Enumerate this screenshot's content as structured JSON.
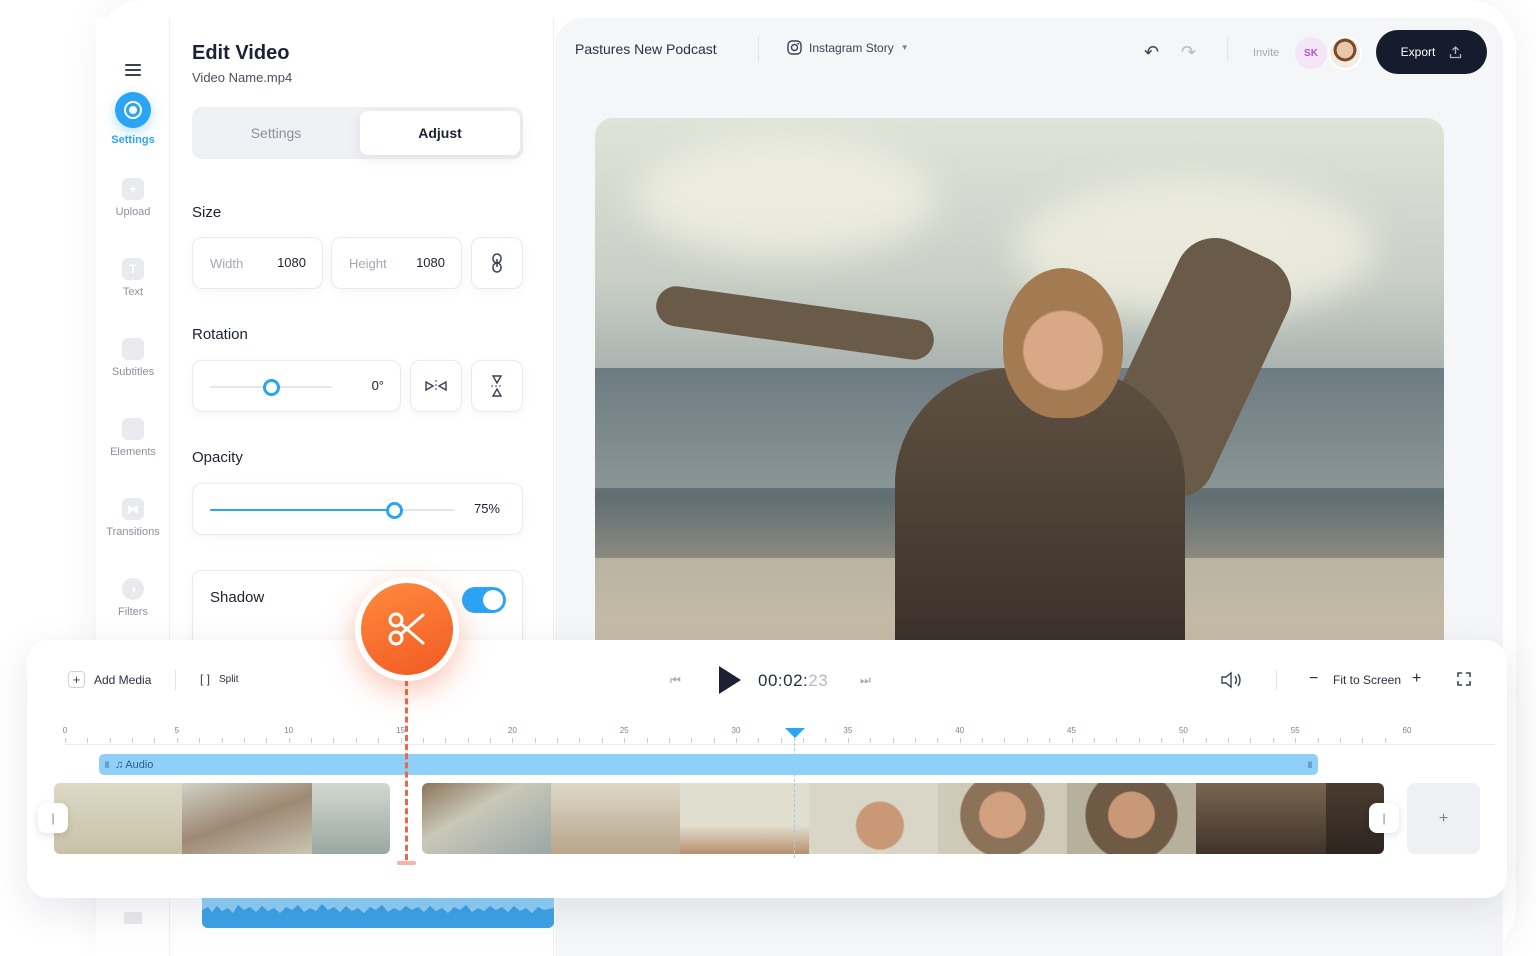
{
  "rail": {
    "items": [
      {
        "label": "Settings",
        "icon": "settings-icon"
      },
      {
        "label": "Upload",
        "icon": "upload-icon"
      },
      {
        "label": "Text",
        "icon": "text-icon"
      },
      {
        "label": "Subtitles",
        "icon": "subtitles-icon"
      },
      {
        "label": "Elements",
        "icon": "elements-icon"
      },
      {
        "label": "Transitions",
        "icon": "transitions-icon"
      },
      {
        "label": "Filters",
        "icon": "filters-icon"
      }
    ],
    "text_icon_glyph": "T"
  },
  "panel": {
    "title": "Edit Video",
    "filename": "Video Name.mp4",
    "tabs": {
      "settings": "Settings",
      "adjust": "Adjust",
      "active": "Adjust"
    },
    "size": {
      "label": "Size",
      "width_label": "Width",
      "width_value": "1080",
      "height_label": "Height",
      "height_value": "1080"
    },
    "rotation": {
      "label": "Rotation",
      "value": "0°",
      "level": 0.5
    },
    "opacity": {
      "label": "Opacity",
      "value": "75%",
      "level": 0.75
    },
    "shadow": {
      "label": "Shadow",
      "enabled": true
    }
  },
  "topbar": {
    "project_title": "Pastures New Podcast",
    "format": "Instagram Story",
    "invite": "Invite",
    "avatar_initials": "SK",
    "export": "Export"
  },
  "timeline": {
    "add_media": "Add Media",
    "split": "Split",
    "time_main": "00:02:",
    "time_frames": "23",
    "fit_to_screen": "Fit to Screen",
    "audio_label": "Audio",
    "ruler_labels": [
      "0",
      "5",
      "10",
      "15",
      "20",
      "25",
      "30",
      "35",
      "40",
      "45",
      "50",
      "55",
      "60"
    ],
    "add_clip": "+"
  },
  "colors": {
    "accent": "#2aa4f4",
    "cut": "#f25a24",
    "export_bg": "#151c2e"
  }
}
